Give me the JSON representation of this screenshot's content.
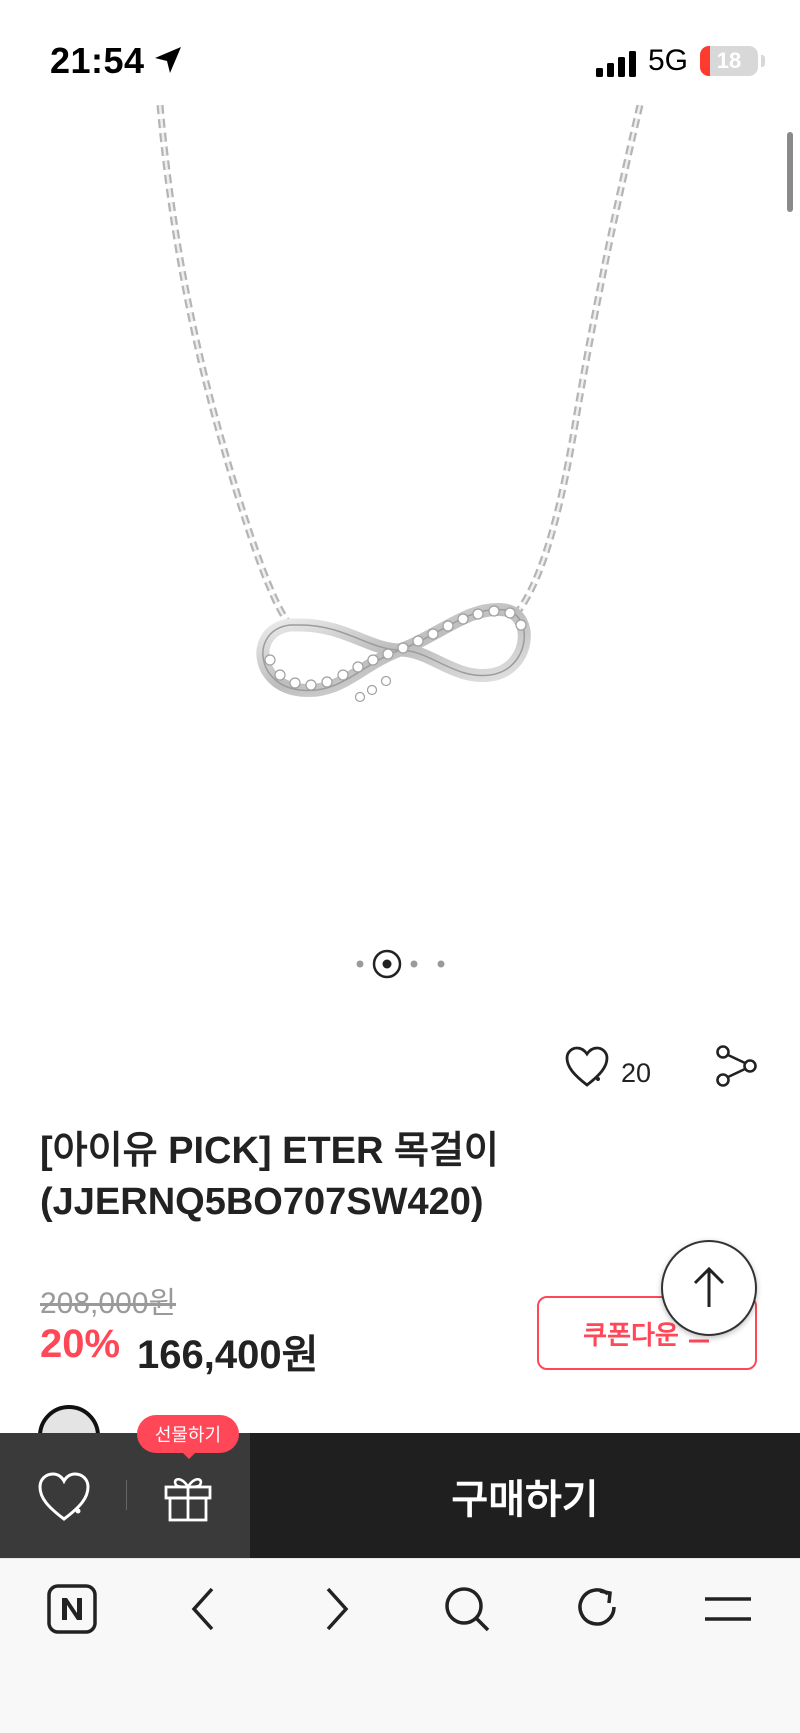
{
  "status_bar": {
    "time": "21:54",
    "network": "5G",
    "battery": "18",
    "battery_level": 0.18
  },
  "product": {
    "title_line1": "[아이유 PICK] ETER 목걸이",
    "title_line2": "(JJERNQ5BO707SW420)",
    "wish_count": "20",
    "original_price": "208,000원",
    "discount": "20%",
    "sale_price": "166,400원",
    "coupon_label": "쿠폰다운",
    "carousel": {
      "total": 4,
      "active": 2
    }
  },
  "purchase_bar": {
    "gift_tooltip": "선물하기",
    "buy_label": "구매하기"
  },
  "colors": {
    "accent": "#ff4757",
    "bar_dark": "#1f1f1f",
    "bar_left": "#3a3a3a"
  },
  "icons": [
    "location-arrow-icon",
    "signal-icon",
    "heart-icon",
    "share-icon",
    "arrow-up-icon",
    "gift-icon",
    "naver-icon",
    "back-icon",
    "forward-icon",
    "search-icon",
    "refresh-icon",
    "menu-icon"
  ]
}
